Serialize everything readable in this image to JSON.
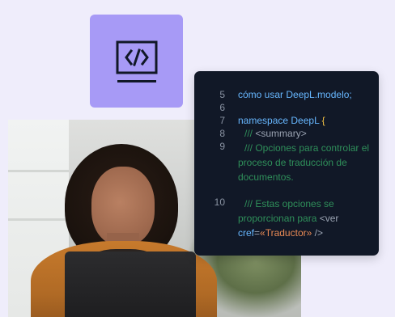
{
  "icon": {
    "name": "code-icon"
  },
  "photo": {
    "subject": "woman-with-laptop"
  },
  "code": {
    "lines": [
      {
        "n": "5",
        "text": "cómo usar DeepL.modelo;"
      },
      {
        "n": "6",
        "text": ""
      },
      {
        "n": "7",
        "text_a": "namespace",
        "text_b": "DeepL",
        "text_c": "{"
      },
      {
        "n": "8",
        "text_a": "///",
        "text_b": "<summary>"
      },
      {
        "n": "9",
        "text": "///  Opciones para controlar el proceso de traducción de documentos."
      },
      {
        "n": "10",
        "text_a": "///  Estas opciones se proporcionan para",
        "text_b": "<ver",
        "text_c": "cref=«Traductor»",
        "text_d": "/>"
      }
    ]
  },
  "colors": {
    "background": "#efedfb",
    "tile": "#a79af6",
    "code_bg": "#111827"
  }
}
